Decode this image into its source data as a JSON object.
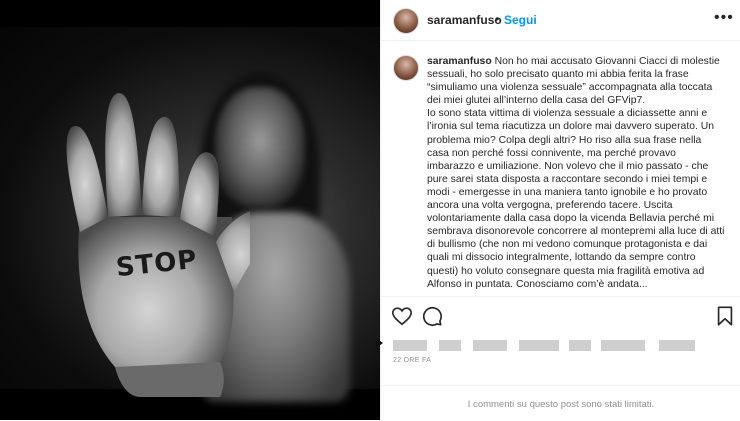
{
  "header": {
    "username": "saramanfuso",
    "separator": "•",
    "follow_label": "Segui",
    "more_label": "•••"
  },
  "photo": {
    "hand_text": "STOP"
  },
  "caption": {
    "username": "saramanfuso",
    "paragraph1": "Non ho mai accusato Giovanni Ciacci di molestie sessuali, ho solo precisato quanto mi abbia ferita la frase “simuliamo una violenza sessuale” accompagnata alla toccata dei miei glutei all’interno della casa del GFVip7.",
    "paragraph2": "Io sono stata vittima di violenza sessuale a diciassette anni e l’ironia sul tema riacutizza un dolore mai davvero superato. Un problema mio? Colpa degli altri? Ho riso alla sua frase nella casa non perché fossi connivente, ma perché provavo imbarazzo e umiliazione. Non volevo che il mio passato - che pure sarei stata disposta a raccontare secondo i miei tempi e modi - emergesse in una maniera tanto ignobile e ho provato ancora una volta vergogna, preferendo tacere. Uscita volontariamente dalla casa dopo la vicenda Bellavia perché mi sembrava disonorevole concorrere al montepremi alla luce di atti di bullismo (che non mi vedono comunque protagonista e dai quali mi dissocio integralmente, lottando da sempre contro questi) ho voluto consegnare questa mia fragilità emotiva ad Alfonso in puntata. Conosciamo com’è andata..."
  },
  "actions": {
    "like_icon": "heart-icon",
    "comment_icon": "comment-icon",
    "save_icon": "bookmark-icon"
  },
  "date": "22 ORE FA",
  "comments_notice": "I commenti su questo post sono stati limitati."
}
